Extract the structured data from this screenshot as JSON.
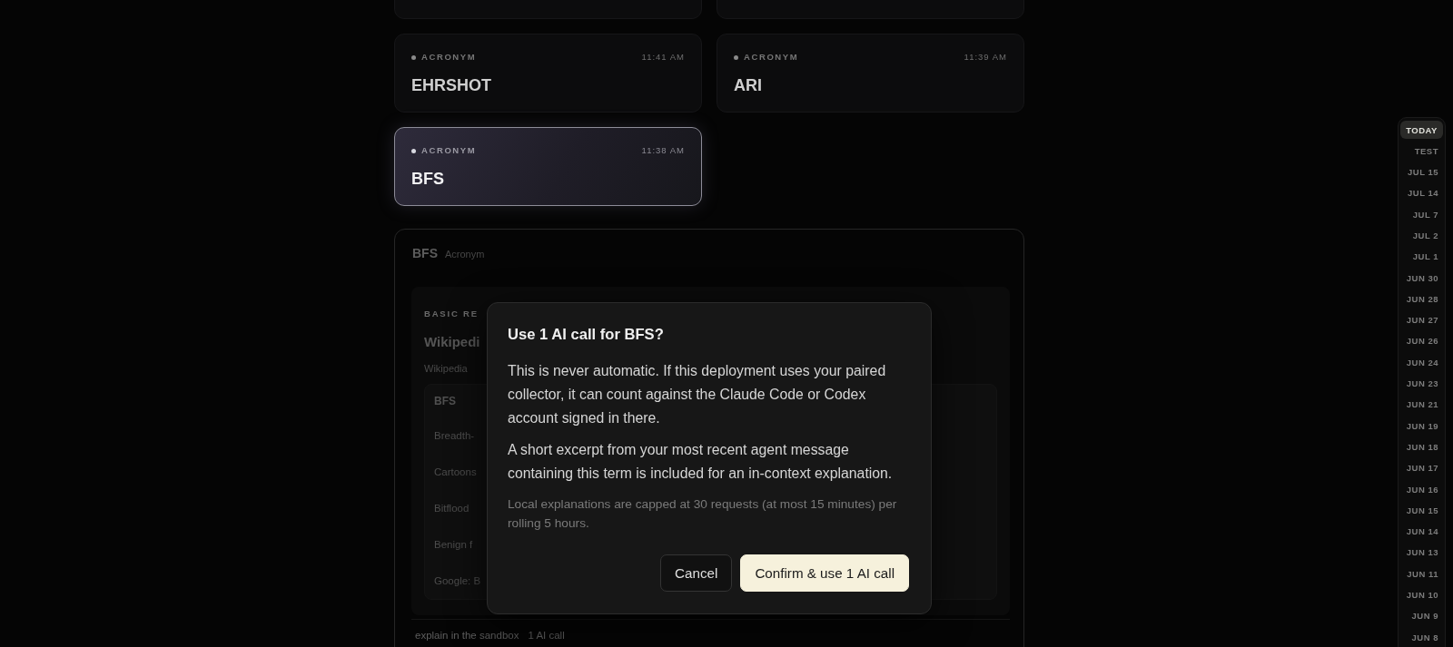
{
  "cards": [
    {
      "kind": "cut",
      "selected": false
    },
    {
      "kind": "cut",
      "selected": false
    },
    {
      "kind": "entry",
      "tag": "ACRONYM",
      "time": "11:41 AM",
      "term": "EHRSHOT",
      "selected": false
    },
    {
      "kind": "entry",
      "tag": "ACRONYM",
      "time": "11:39 AM",
      "term": "ARI",
      "selected": false
    },
    {
      "kind": "entry",
      "tag": "ACRONYM",
      "time": "11:38 AM",
      "term": "BFS",
      "selected": true
    }
  ],
  "detail": {
    "term": "BFS",
    "type": "Acronym",
    "section_label": "BASIC RE",
    "source_title": "Wikipedi",
    "source_note": "Wikipedia",
    "sub_card": {
      "term": "BFS",
      "items": [
        "Breadth-",
        "Cartoons",
        "Bitflood",
        "Benign f",
        "Google: B"
      ]
    },
    "footer": {
      "action": "explain in the sandbox",
      "cost": "1 AI call"
    }
  },
  "dialog": {
    "title": "Use 1 AI call for BFS?",
    "paragraphs": [
      "This is never automatic. If this deployment uses your paired collector, it can count against the Claude Code or Codex account signed in there.",
      "A short excerpt from your most recent agent message containing this term is included for an in-context explanation."
    ],
    "note": "Local explanations are capped at 30 requests (at most 15 minutes) per rolling 5 hours.",
    "buttons": [
      {
        "label": "Cancel",
        "kind": "secondary"
      },
      {
        "label": "Confirm & use 1 AI call",
        "kind": "primary"
      }
    ]
  },
  "date_rail": {
    "items": [
      {
        "label": "TODAY",
        "selected": true
      },
      {
        "label": "TEST",
        "selected": false
      },
      {
        "label": "JUL 15",
        "selected": false
      },
      {
        "label": "JUL 14",
        "selected": false
      },
      {
        "label": "JUL 7",
        "selected": false
      },
      {
        "label": "JUL 2",
        "selected": false
      },
      {
        "label": "JUL 1",
        "selected": false
      },
      {
        "label": "JUN 30",
        "selected": false
      },
      {
        "label": "JUN 28",
        "selected": false
      },
      {
        "label": "JUN 27",
        "selected": false
      },
      {
        "label": "JUN 26",
        "selected": false
      },
      {
        "label": "JUN 24",
        "selected": false
      },
      {
        "label": "JUN 23",
        "selected": false
      },
      {
        "label": "JUN 21",
        "selected": false
      },
      {
        "label": "JUN 19",
        "selected": false
      },
      {
        "label": "JUN 18",
        "selected": false
      },
      {
        "label": "JUN 17",
        "selected": false
      },
      {
        "label": "JUN 16",
        "selected": false
      },
      {
        "label": "JUN 15",
        "selected": false
      },
      {
        "label": "JUN 14",
        "selected": false
      },
      {
        "label": "JUN 13",
        "selected": false
      },
      {
        "label": "JUN 11",
        "selected": false
      },
      {
        "label": "JUN 10",
        "selected": false
      },
      {
        "label": "JUN 9",
        "selected": false
      },
      {
        "label": "JUN 8",
        "selected": false
      }
    ]
  }
}
